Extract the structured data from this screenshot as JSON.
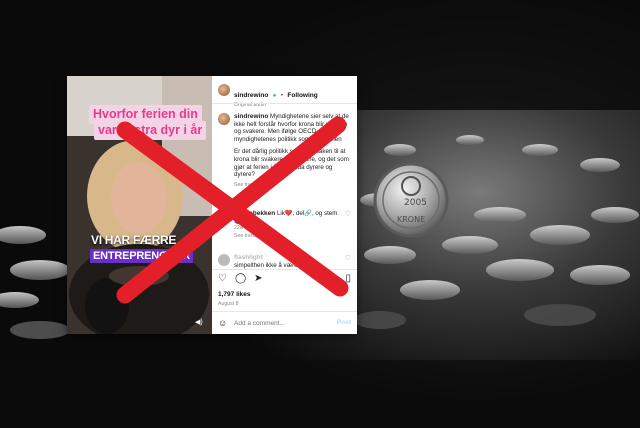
{
  "video": {
    "caption_line1": "Hvorfor ferien din",
    "caption_line2": "var ekstra dyr i år",
    "subtitle_line1": "VI HAR FÆRRE",
    "subtitle_line2": "ENTREPRENØRER"
  },
  "post": {
    "username": "sindrewino",
    "follow_status": "Following",
    "audio": "Original audio",
    "caption_user": "sindrewino",
    "caption_text_1": "Myndighetene sier selv at de ikke helt forstår hvorfor krona blir svakere og svakere. Men ifølge OECD er det myndighetenes politikk som er grunnen",
    "caption_text_2": "Er det dårlig politikk som er årsaken til at krona blir svakere og svakere, og det som gjør at ferien i år ble enda dyrere og dyrere?",
    "see_translation": "See translation",
    "comment1_user": "emmabekken",
    "comment1_text": "Lik❤️, del🔗, og stem🗳️",
    "comment1_meta": "22w  Reply",
    "comment1_translation": "See translation",
    "comment2_user": "flashlight",
    "comment2_text": "simpelthen ikke å være",
    "likes": "1,797 likes",
    "date": "August 8",
    "add_comment_placeholder": "Add a comment...",
    "post_button": "Post"
  },
  "colors": {
    "caption_pink": "#e53c8a",
    "caption_bg": "#f4d3e8",
    "subtitle_purple": "#6b2fc7",
    "cross_red": "#e3202a",
    "link_blue": "#0095f6"
  }
}
